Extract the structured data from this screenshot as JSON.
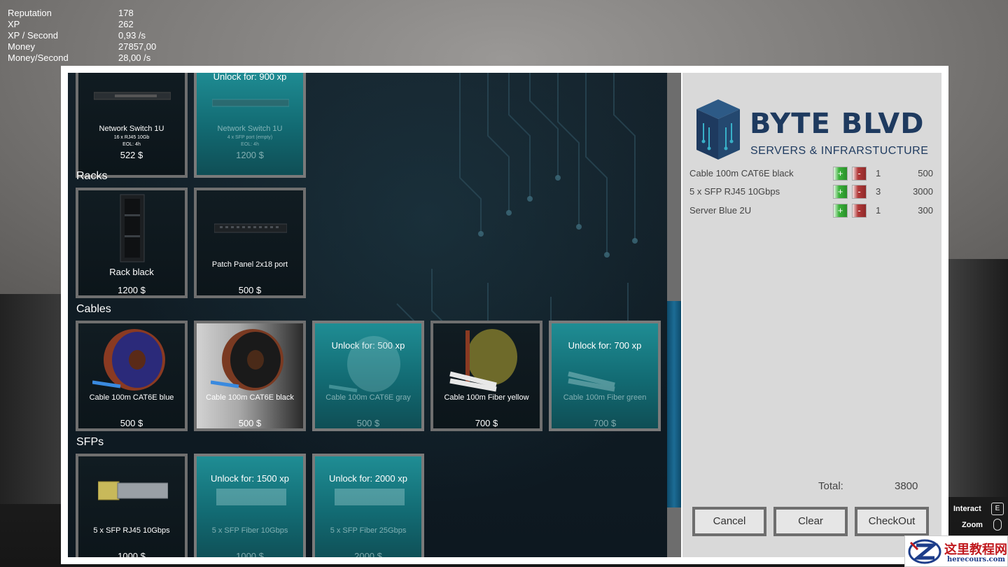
{
  "stats": [
    {
      "label": "Reputation",
      "value": "178"
    },
    {
      "label": "XP",
      "value": "262"
    },
    {
      "label": "XP / Second",
      "value": "0,93 /s"
    },
    {
      "label": "Money",
      "value": "27857,00"
    },
    {
      "label": "Money/Second",
      "value": "28,00 /s"
    }
  ],
  "shop": {
    "switches": [
      {
        "name": "Network Switch 1U",
        "sub1": "16 x RJ45 10Gb",
        "sub2": "EOL: 4h",
        "price": "522 $",
        "locked": false
      },
      {
        "name": "Network Switch 1U",
        "sub1": "4 x SFP port (empty)",
        "sub2": "EOL: 4h",
        "price": "1200 $",
        "locked": true,
        "unlock": "Unlock for: 900 xp"
      }
    ],
    "sections": {
      "racks": "Racks",
      "cables": "Cables",
      "sfps": "SFPs"
    },
    "racks": [
      {
        "name": "Rack black",
        "price": "1200 $"
      },
      {
        "name": "Patch Panel 2x18 port",
        "price": "500 $"
      }
    ],
    "cables": [
      {
        "name": "Cable 100m CAT6E blue",
        "price": "500 $",
        "locked": false
      },
      {
        "name": "Cable 100m CAT6E black",
        "price": "500 $",
        "locked": false
      },
      {
        "name": "Cable 100m CAT6E gray",
        "price": "500 $",
        "locked": true,
        "unlock": "Unlock for: 500 xp"
      },
      {
        "name": "Cable 100m Fiber yellow",
        "price": "700 $",
        "locked": false
      },
      {
        "name": "Cable 100m Fiber green",
        "price": "700 $",
        "locked": true,
        "unlock": "Unlock for: 700 xp"
      }
    ],
    "sfps": [
      {
        "name": "5 x SFP RJ45 10Gbps",
        "price": "1000 $",
        "locked": false
      },
      {
        "name": "5 x SFP Fiber 10Gbps",
        "price": "1000 $",
        "locked": true,
        "unlock": "Unlock for: 1500 xp"
      },
      {
        "name": "5 x SFP Fiber 25Gbps",
        "price": "2000 $",
        "locked": true,
        "unlock": "Unlock for: 2000 xp"
      }
    ]
  },
  "cart": {
    "logo_title": "BYTE BLVD",
    "logo_sub": "SERVERS & INFRARSTUCTURE",
    "items": [
      {
        "name": "Cable 100m CAT6E black",
        "plus": "+",
        "minus": "-",
        "qty": "1",
        "price": "500"
      },
      {
        "name": "5 x SFP RJ45 10Gbps",
        "plus": "+",
        "minus": "-",
        "qty": "3",
        "price": "3000"
      },
      {
        "name": "Server Blue 2U",
        "plus": "+",
        "minus": "-",
        "qty": "1",
        "price": "300"
      }
    ],
    "total_label": "Total:",
    "total_value": "3800",
    "buttons": {
      "cancel": "Cancel",
      "clear": "Clear",
      "checkout": "CheckOut"
    }
  },
  "hud": {
    "interact_label": "Interact",
    "interact_key": "E",
    "zoom_label": "Zoom"
  },
  "watermark": {
    "title": "这里教程网",
    "url": "herecours.com"
  },
  "colors": {
    "accent_locked": "#1f8d94",
    "logo_navy": "#1e3a5f",
    "scroll_thumb": "#1c6c95"
  }
}
